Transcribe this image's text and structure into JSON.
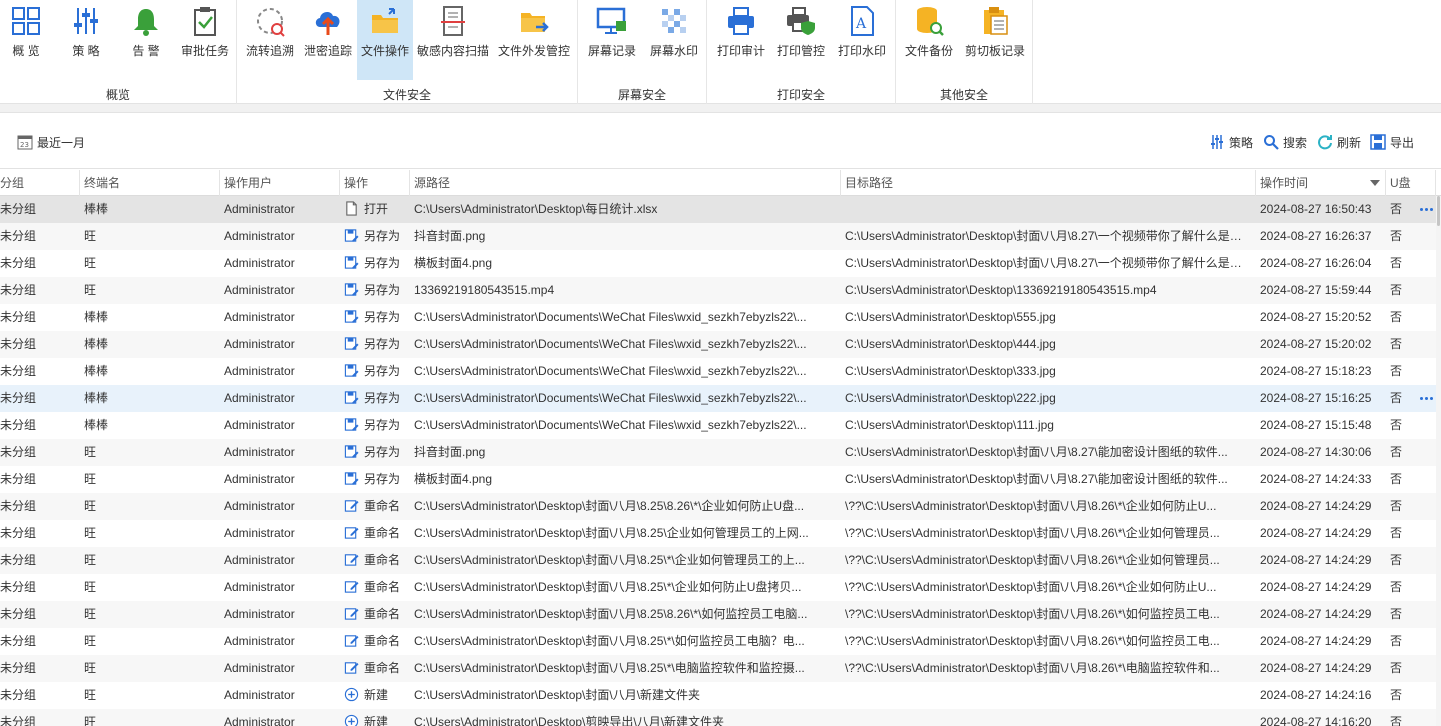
{
  "ribbon": {
    "groups": [
      {
        "title": "概览",
        "buttons": [
          {
            "label": "概  览",
            "icon": "overview-grid-icon"
          },
          {
            "label": "策  略",
            "icon": "policy-sliders-icon"
          },
          {
            "label": "告  警",
            "icon": "alarm-bell-icon"
          },
          {
            "label": "审批任务",
            "icon": "approval-clipboard-icon"
          }
        ]
      },
      {
        "title": "文件安全",
        "buttons": [
          {
            "label": "流转追溯",
            "icon": "trace-flow-icon"
          },
          {
            "label": "泄密追踪",
            "icon": "cloud-upload-icon"
          },
          {
            "label": "文件操作",
            "icon": "folder-action-icon"
          },
          {
            "label": "敏感内容扫描",
            "icon": "document-scan-icon"
          },
          {
            "label": "文件外发管控",
            "icon": "folder-send-icon"
          }
        ]
      },
      {
        "title": "屏幕安全",
        "buttons": [
          {
            "label": "屏幕记录",
            "icon": "screen-record-icon"
          },
          {
            "label": "屏幕水印",
            "icon": "watermark-icon"
          }
        ]
      },
      {
        "title": "打印安全",
        "buttons": [
          {
            "label": "打印审计",
            "icon": "printer-icon"
          },
          {
            "label": "打印管控",
            "icon": "printer-shield-icon"
          },
          {
            "label": "打印水印",
            "icon": "print-watermark-icon"
          }
        ]
      },
      {
        "title": "其他安全",
        "buttons": [
          {
            "label": "文件备份",
            "icon": "database-backup-icon"
          },
          {
            "label": "剪切板记录",
            "icon": "clipboard-icon"
          }
        ]
      }
    ]
  },
  "toolbar": {
    "date_range": "最近一月",
    "policy": "策略",
    "search": "搜索",
    "refresh": "刷新",
    "export": "导出"
  },
  "table": {
    "columns": [
      "分组",
      "终端名",
      "操作用户",
      "操作",
      "源路径",
      "目标路径",
      "操作时间",
      "U盘"
    ],
    "rows": [
      {
        "group": "未分组",
        "terminal": "棒棒",
        "user": "Administrator",
        "op": "打开",
        "op_icon": "file-open-icon",
        "src": "C:\\Users\\Administrator\\Desktop\\每日统计.xlsx",
        "dst": "",
        "time": "2024-08-27 16:50:43",
        "usb": "否"
      },
      {
        "group": "未分组",
        "terminal": "旺",
        "user": "Administrator",
        "op": "另存为",
        "op_icon": "save-as-icon",
        "src": "抖音封面.png",
        "dst": "C:\\Users\\Administrator\\Desktop\\封面\\八月\\8.27\\一个视频带你了解什么是数据...",
        "time": "2024-08-27 16:26:37",
        "usb": "否"
      },
      {
        "group": "未分组",
        "terminal": "旺",
        "user": "Administrator",
        "op": "另存为",
        "op_icon": "save-as-icon",
        "src": "横板封面4.png",
        "dst": "C:\\Users\\Administrator\\Desktop\\封面\\八月\\8.27\\一个视频带你了解什么是数据...",
        "time": "2024-08-27 16:26:04",
        "usb": "否"
      },
      {
        "group": "未分组",
        "terminal": "旺",
        "user": "Administrator",
        "op": "另存为",
        "op_icon": "save-as-icon",
        "src": "13369219180543515.mp4",
        "dst": "C:\\Users\\Administrator\\Desktop\\13369219180543515.mp4",
        "time": "2024-08-27 15:59:44",
        "usb": "否"
      },
      {
        "group": "未分组",
        "terminal": "棒棒",
        "user": "Administrator",
        "op": "另存为",
        "op_icon": "save-as-icon",
        "src": "C:\\Users\\Administrator\\Documents\\WeChat Files\\wxid_sezkh7ebyzls22\\...",
        "dst": "C:\\Users\\Administrator\\Desktop\\555.jpg",
        "time": "2024-08-27 15:20:52",
        "usb": "否"
      },
      {
        "group": "未分组",
        "terminal": "棒棒",
        "user": "Administrator",
        "op": "另存为",
        "op_icon": "save-as-icon",
        "src": "C:\\Users\\Administrator\\Documents\\WeChat Files\\wxid_sezkh7ebyzls22\\...",
        "dst": "C:\\Users\\Administrator\\Desktop\\444.jpg",
        "time": "2024-08-27 15:20:02",
        "usb": "否"
      },
      {
        "group": "未分组",
        "terminal": "棒棒",
        "user": "Administrator",
        "op": "另存为",
        "op_icon": "save-as-icon",
        "src": "C:\\Users\\Administrator\\Documents\\WeChat Files\\wxid_sezkh7ebyzls22\\...",
        "dst": "C:\\Users\\Administrator\\Desktop\\333.jpg",
        "time": "2024-08-27 15:18:23",
        "usb": "否"
      },
      {
        "group": "未分组",
        "terminal": "棒棒",
        "user": "Administrator",
        "op": "另存为",
        "op_icon": "save-as-icon",
        "src": "C:\\Users\\Administrator\\Documents\\WeChat Files\\wxid_sezkh7ebyzls22\\...",
        "dst": "C:\\Users\\Administrator\\Desktop\\222.jpg",
        "time": "2024-08-27 15:16:25",
        "usb": "否"
      },
      {
        "group": "未分组",
        "terminal": "棒棒",
        "user": "Administrator",
        "op": "另存为",
        "op_icon": "save-as-icon",
        "src": "C:\\Users\\Administrator\\Documents\\WeChat Files\\wxid_sezkh7ebyzls22\\...",
        "dst": "C:\\Users\\Administrator\\Desktop\\111.jpg",
        "time": "2024-08-27 15:15:48",
        "usb": "否"
      },
      {
        "group": "未分组",
        "terminal": "旺",
        "user": "Administrator",
        "op": "另存为",
        "op_icon": "save-as-icon",
        "src": "抖音封面.png",
        "dst": "C:\\Users\\Administrator\\Desktop\\封面\\八月\\8.27\\能加密设计图纸的软件...",
        "time": "2024-08-27 14:30:06",
        "usb": "否"
      },
      {
        "group": "未分组",
        "terminal": "旺",
        "user": "Administrator",
        "op": "另存为",
        "op_icon": "save-as-icon",
        "src": "横板封面4.png",
        "dst": "C:\\Users\\Administrator\\Desktop\\封面\\八月\\8.27\\能加密设计图纸的软件...",
        "time": "2024-08-27 14:24:33",
        "usb": "否"
      },
      {
        "group": "未分组",
        "terminal": "旺",
        "user": "Administrator",
        "op": "重命名",
        "op_icon": "rename-icon",
        "src": "C:\\Users\\Administrator\\Desktop\\封面\\八月\\8.25\\8.26\\*\\企业如何防止U盘...",
        "dst": "\\??\\C:\\Users\\Administrator\\Desktop\\封面\\八月\\8.26\\*\\企业如何防止U...",
        "time": "2024-08-27 14:24:29",
        "usb": "否"
      },
      {
        "group": "未分组",
        "terminal": "旺",
        "user": "Administrator",
        "op": "重命名",
        "op_icon": "rename-icon",
        "src": "C:\\Users\\Administrator\\Desktop\\封面\\八月\\8.25\\企业如何管理员工的上网...",
        "dst": "\\??\\C:\\Users\\Administrator\\Desktop\\封面\\八月\\8.26\\*\\企业如何管理员...",
        "time": "2024-08-27 14:24:29",
        "usb": "否"
      },
      {
        "group": "未分组",
        "terminal": "旺",
        "user": "Administrator",
        "op": "重命名",
        "op_icon": "rename-icon",
        "src": "C:\\Users\\Administrator\\Desktop\\封面\\八月\\8.25\\*\\企业如何管理员工的上...",
        "dst": "\\??\\C:\\Users\\Administrator\\Desktop\\封面\\八月\\8.26\\*\\企业如何管理员...",
        "time": "2024-08-27 14:24:29",
        "usb": "否"
      },
      {
        "group": "未分组",
        "terminal": "旺",
        "user": "Administrator",
        "op": "重命名",
        "op_icon": "rename-icon",
        "src": "C:\\Users\\Administrator\\Desktop\\封面\\八月\\8.25\\*\\企业如何防止U盘拷贝...",
        "dst": "\\??\\C:\\Users\\Administrator\\Desktop\\封面\\八月\\8.26\\*\\企业如何防止U...",
        "time": "2024-08-27 14:24:29",
        "usb": "否"
      },
      {
        "group": "未分组",
        "terminal": "旺",
        "user": "Administrator",
        "op": "重命名",
        "op_icon": "rename-icon",
        "src": "C:\\Users\\Administrator\\Desktop\\封面\\八月\\8.25\\8.26\\*\\如何监控员工电脑...",
        "dst": "\\??\\C:\\Users\\Administrator\\Desktop\\封面\\八月\\8.26\\*\\如何监控员工电...",
        "time": "2024-08-27 14:24:29",
        "usb": "否"
      },
      {
        "group": "未分组",
        "terminal": "旺",
        "user": "Administrator",
        "op": "重命名",
        "op_icon": "rename-icon",
        "src": "C:\\Users\\Administrator\\Desktop\\封面\\八月\\8.25\\*\\如何监控员工电脑？电...",
        "dst": "\\??\\C:\\Users\\Administrator\\Desktop\\封面\\八月\\8.26\\*\\如何监控员工电...",
        "time": "2024-08-27 14:24:29",
        "usb": "否"
      },
      {
        "group": "未分组",
        "terminal": "旺",
        "user": "Administrator",
        "op": "重命名",
        "op_icon": "rename-icon",
        "src": "C:\\Users\\Administrator\\Desktop\\封面\\八月\\8.25\\*\\电脑监控软件和监控摄...",
        "dst": "\\??\\C:\\Users\\Administrator\\Desktop\\封面\\八月\\8.26\\*\\电脑监控软件和...",
        "time": "2024-08-27 14:24:29",
        "usb": "否"
      },
      {
        "group": "未分组",
        "terminal": "旺",
        "user": "Administrator",
        "op": "新建",
        "op_icon": "new-plus-icon",
        "src": "C:\\Users\\Administrator\\Desktop\\封面\\八月\\新建文件夹",
        "dst": "",
        "time": "2024-08-27 14:24:16",
        "usb": "否"
      },
      {
        "group": "未分组",
        "terminal": "旺",
        "user": "Administrator",
        "op": "新建",
        "op_icon": "new-plus-icon",
        "src": "C:\\Users\\Administrator\\Desktop\\剪映导出\\八月\\新建文件夹",
        "dst": "",
        "time": "2024-08-27 14:16:20",
        "usb": "否"
      }
    ]
  },
  "colors": {
    "accent": "#2a6fd6",
    "active_button": "#cfe6f7",
    "selected_row": "#e4e4e4",
    "hover_row": "#e8f2fb"
  }
}
